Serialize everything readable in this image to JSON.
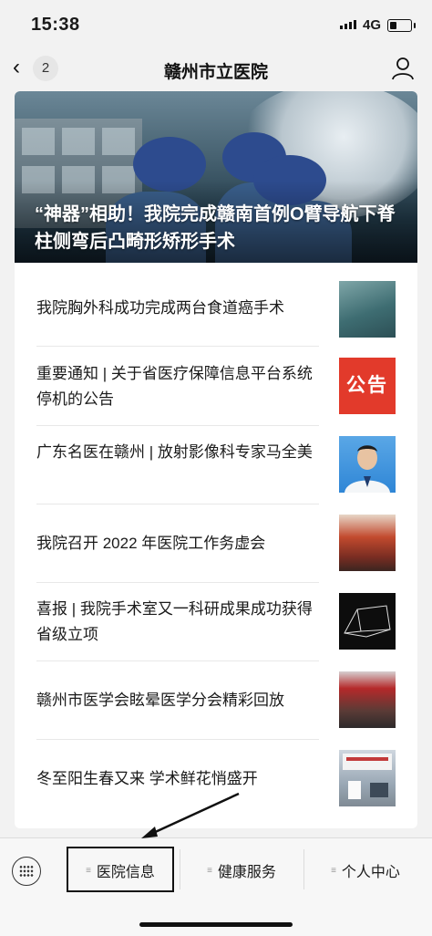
{
  "status": {
    "time": "15:38",
    "network": "4G"
  },
  "nav": {
    "back_count": "2",
    "title": "赣州市立医院"
  },
  "hero": {
    "caption": "“神器”相助！我院完成赣南首例O臂导航下脊柱侧弯后凸畸形矫形手术"
  },
  "articles": [
    {
      "title": "我院胸外科成功完成两台食道癌手术",
      "thumb": "surgery-photo"
    },
    {
      "title": "重要通知 | 关于省医疗保障信息平台系统停机的公告",
      "thumb": "notice-banner",
      "thumb_text": "公告"
    },
    {
      "title": "广东名医在赣州 | 放射影像科专家马全美",
      "thumb": "doctor-portrait"
    },
    {
      "title": "我院召开 2022 年医院工作务虚会",
      "thumb": "meeting-photo"
    },
    {
      "title": "喜报 | 我院手术室又一科研成果成功获得省级立项",
      "thumb": "device-diagram"
    },
    {
      "title": "赣州市医学会眩晕医学分会精彩回放",
      "thumb": "group-photo"
    },
    {
      "title": "冬至阳生春又来 学术鲜花悄盛开",
      "thumb": "lecture-photo"
    }
  ],
  "menu": [
    {
      "label": "医院信息"
    },
    {
      "label": "健康服务"
    },
    {
      "label": "个人中心"
    }
  ],
  "colors": {
    "notice_red": "#e23a2b",
    "card_bg": "#ffffff",
    "page_bg": "#f2f2f2"
  }
}
